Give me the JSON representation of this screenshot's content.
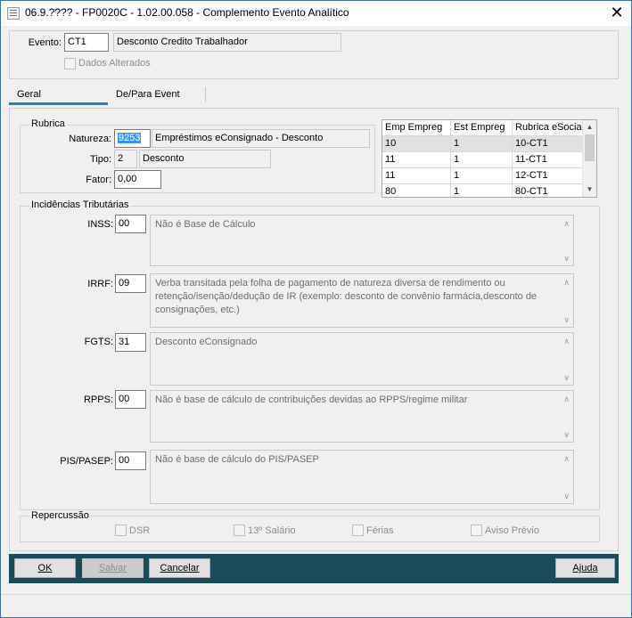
{
  "window": {
    "title": "06.9.???? - FP0020C - 1.02.00.058 - Complemento Evento Analítico"
  },
  "header": {
    "evento_label": "Evento:",
    "evento_code": "CT1",
    "evento_desc": "Desconto Credito Trabalhador",
    "dados_alterados": "Dados Alterados"
  },
  "tabs": [
    {
      "label": "Geral"
    },
    {
      "label": "De/Para Event"
    }
  ],
  "rubrica": {
    "title": "Rubrica",
    "natureza_label": "Natureza:",
    "natureza_code": "9253",
    "natureza_desc": "Empréstimos eConsignado - Desconto",
    "tipo_label": "Tipo:",
    "tipo_code": "2",
    "tipo_desc": "Desconto",
    "fator_label": "Fator:",
    "fator_value": "0,00"
  },
  "grid": {
    "columns": [
      "Emp Empreg",
      "Est Empreg",
      "Rubrica eSocial"
    ],
    "rows": [
      [
        "10",
        "1",
        "10-CT1"
      ],
      [
        "11",
        "1",
        "11-CT1"
      ],
      [
        "11",
        "1",
        "12-CT1"
      ],
      [
        "80",
        "1",
        "80-CT1"
      ]
    ]
  },
  "incidencias": {
    "title": "Incidências Tributárias",
    "inss_label": "INSS:",
    "inss_code": "00",
    "inss_desc": "Não é Base de Cálculo",
    "irrf_label": "IRRF:",
    "irrf_code": "09",
    "irrf_desc": "Verba transitada pela folha de pagamento de natureza diversa de rendimento ou retenção/isenção/dedução de IR (exemplo: desconto de convênio farmácia,desconto de consignações, etc.)",
    "fgts_label": "FGTS:",
    "fgts_code": "31",
    "fgts_desc": "Desconto eConsignado",
    "rpps_label": "RPPS:",
    "rpps_code": "00",
    "rpps_desc": "Não é base de cálculo de contribuições devidas ao RPPS/regime militar",
    "pis_label": "PIS/PASEP:",
    "pis_code": "00",
    "pis_desc": "Não é base de cálculo do PIS/PASEP"
  },
  "repercussao": {
    "title": "Repercussão",
    "dsr": "DSR",
    "salario13": "13º Salário",
    "ferias": "Férias",
    "aviso": "Aviso Prévio"
  },
  "buttons": {
    "ok": "OK",
    "salvar": "Salvar",
    "cancelar": "Cancelar",
    "ajuda": "Ajuda"
  },
  "colors": {
    "footer": "#1b4a5a",
    "selection": "#3399ff",
    "tab_accent": "#1a86c7"
  }
}
